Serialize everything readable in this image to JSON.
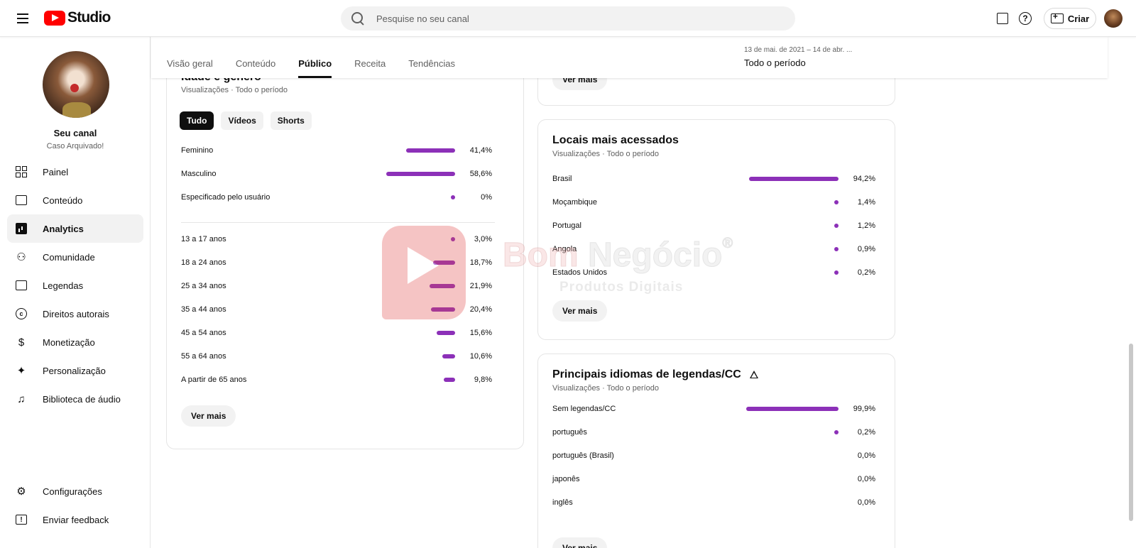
{
  "topbar": {
    "logo_text": "Studio",
    "search_placeholder": "Pesquise no seu canal",
    "create_label": "Criar"
  },
  "sidebar": {
    "channel_name": "Seu canal",
    "channel_subtitle": "Caso Arquivado!",
    "items": [
      {
        "label": "Painel",
        "icon": "dashboard-icon"
      },
      {
        "label": "Conteúdo",
        "icon": "content-icon"
      },
      {
        "label": "Analytics",
        "icon": "analytics-icon",
        "active": true
      },
      {
        "label": "Comunidade",
        "icon": "community-icon"
      },
      {
        "label": "Legendas",
        "icon": "subtitles-icon"
      },
      {
        "label": "Direitos autorais",
        "icon": "copyright-icon"
      },
      {
        "label": "Monetização",
        "icon": "dollar-icon"
      },
      {
        "label": "Personalização",
        "icon": "magic-wand-icon"
      },
      {
        "label": "Biblioteca de áudio",
        "icon": "audio-library-icon"
      }
    ],
    "bottom_items": [
      {
        "label": "Configurações",
        "icon": "gear-icon"
      },
      {
        "label": "Enviar feedback",
        "icon": "feedback-icon"
      }
    ]
  },
  "header": {
    "tabs": [
      "Visão geral",
      "Conteúdo",
      "Público",
      "Receita",
      "Tendências"
    ],
    "active_tab": "Público",
    "period_range": "13 de mai. de 2021 – 14 de abr. ...",
    "period_label": "Todo o período"
  },
  "age_gender_card": {
    "title_partial": "Idade e gênero",
    "subtitle": "Visualizações · Todo o período",
    "chips": [
      "Tudo",
      "Vídeos",
      "Shorts"
    ],
    "active_chip": "Tudo",
    "gender": [
      {
        "label": "Feminino",
        "value": "41,4%",
        "pct": 41.4
      },
      {
        "label": "Masculino",
        "value": "58,6%",
        "pct": 58.6
      },
      {
        "label": "Especificado pelo usuário",
        "value": "0%",
        "pct": 0
      }
    ],
    "ages": [
      {
        "label": "13 a 17 anos",
        "value": "3,0%",
        "pct": 3.0
      },
      {
        "label": "18 a 24 anos",
        "value": "18,7%",
        "pct": 18.7
      },
      {
        "label": "25 a 34 anos",
        "value": "21,9%",
        "pct": 21.9
      },
      {
        "label": "35 a 44 anos",
        "value": "20,4%",
        "pct": 20.4
      },
      {
        "label": "45 a 54 anos",
        "value": "15,6%",
        "pct": 15.6
      },
      {
        "label": "55 a 64 anos",
        "value": "10,6%",
        "pct": 10.6
      },
      {
        "label": "A partir de 65 anos",
        "value": "9,8%",
        "pct": 9.8
      }
    ],
    "more_label": "Ver mais"
  },
  "top_card": {
    "more_label": "Ver mais"
  },
  "locations_card": {
    "title": "Locais mais acessados",
    "subtitle": "Visualizações · Todo o período",
    "rows": [
      {
        "label": "Brasil",
        "value": "94,2%",
        "pct": 94.2
      },
      {
        "label": "Moçambique",
        "value": "1,4%",
        "pct": 1.4
      },
      {
        "label": "Portugal",
        "value": "1,2%",
        "pct": 1.2
      },
      {
        "label": "Angola",
        "value": "0,9%",
        "pct": 0.9
      },
      {
        "label": "Estados Unidos",
        "value": "0,2%",
        "pct": 0.2
      }
    ],
    "more_label": "Ver mais"
  },
  "languages_card": {
    "title": "Principais idiomas de legendas/CC",
    "subtitle": "Visualizações · Todo o período",
    "rows": [
      {
        "label": "Sem legendas/CC",
        "value": "99,9%",
        "pct": 99.9
      },
      {
        "label": "português",
        "value": "0,2%",
        "pct": 0.2
      },
      {
        "label": "português (Brasil)",
        "value": "0,0%",
        "pct": 0
      },
      {
        "label": "japonês",
        "value": "0,0%",
        "pct": 0
      },
      {
        "label": "inglês",
        "value": "0,0%",
        "pct": 0
      }
    ],
    "more_label": "Ver mais"
  },
  "watermark": {
    "title_a": "Bom",
    "title_b": "Negócio",
    "registered": "®",
    "subtitle": "Produtos Digitais"
  },
  "colors": {
    "bar": "#8c30b8",
    "brand_red": "#ff0000"
  }
}
